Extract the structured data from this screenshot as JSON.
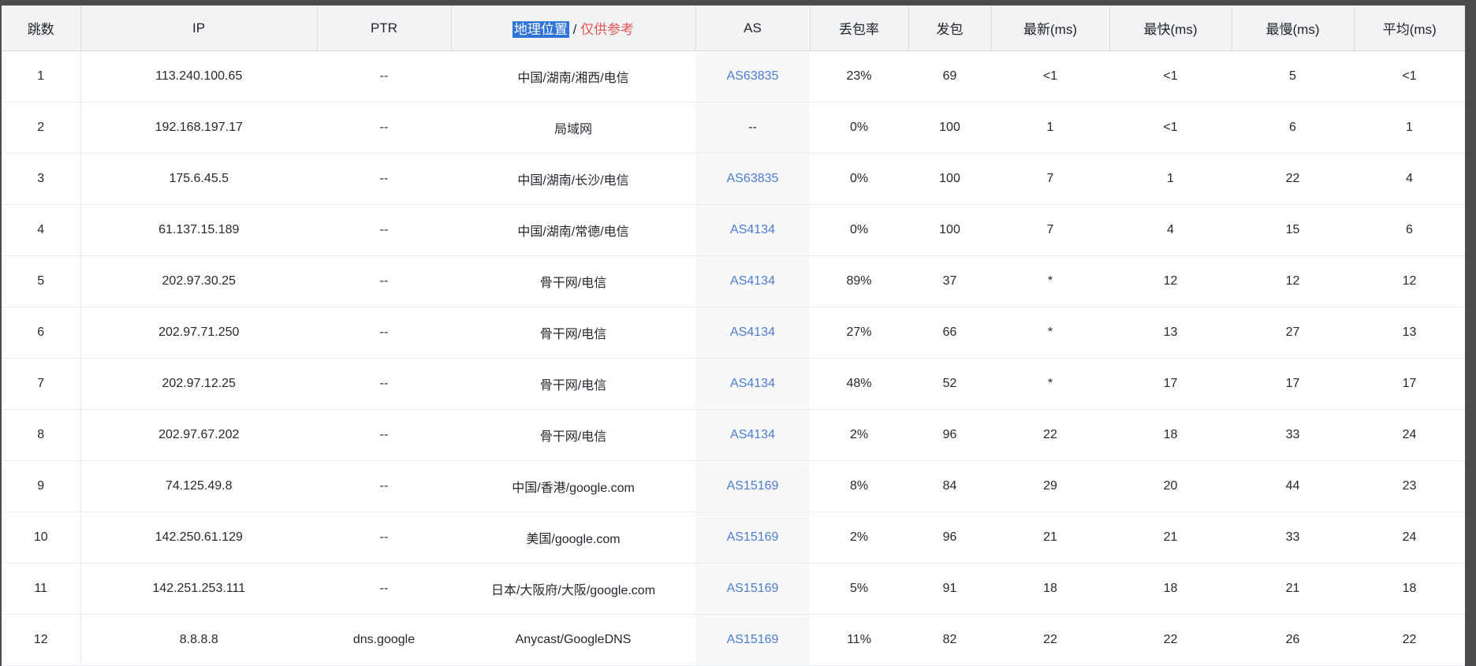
{
  "page": {
    "background_color": "#4c4c4c"
  },
  "table": {
    "header_background": "#f2f3f5",
    "as_link_color": "#4e7bd2",
    "selection_highlight_color": "#2f74d8",
    "note_color": "#e25555",
    "columns": [
      {
        "key": "hop",
        "label": "跳数"
      },
      {
        "key": "ip",
        "label": "IP"
      },
      {
        "key": "ptr",
        "label": "PTR"
      },
      {
        "key": "geo",
        "label": "地理位置",
        "separator": " / ",
        "note": "仅供参考"
      },
      {
        "key": "as",
        "label": "AS"
      },
      {
        "key": "loss",
        "label": "丢包率"
      },
      {
        "key": "sent",
        "label": "发包"
      },
      {
        "key": "latest",
        "label": "最新(ms)"
      },
      {
        "key": "fastest",
        "label": "最快(ms)"
      },
      {
        "key": "slowest",
        "label": "最慢(ms)"
      },
      {
        "key": "average",
        "label": "平均(ms)"
      }
    ],
    "rows": [
      {
        "hop": "1",
        "ip": "113.240.100.65",
        "ptr": "--",
        "geo": "中国/湖南/湘西/电信",
        "as": "AS63835",
        "as_link": true,
        "loss": "23%",
        "sent": "69",
        "latest": "<1",
        "fastest": "<1",
        "slowest": "5",
        "average": "<1"
      },
      {
        "hop": "2",
        "ip": "192.168.197.17",
        "ptr": "--",
        "geo": "局域网",
        "as": "--",
        "as_link": false,
        "loss": "0%",
        "sent": "100",
        "latest": "1",
        "fastest": "<1",
        "slowest": "6",
        "average": "1"
      },
      {
        "hop": "3",
        "ip": "175.6.45.5",
        "ptr": "--",
        "geo": "中国/湖南/长沙/电信",
        "as": "AS63835",
        "as_link": true,
        "loss": "0%",
        "sent": "100",
        "latest": "7",
        "fastest": "1",
        "slowest": "22",
        "average": "4"
      },
      {
        "hop": "4",
        "ip": "61.137.15.189",
        "ptr": "--",
        "geo": "中国/湖南/常德/电信",
        "as": "AS4134",
        "as_link": true,
        "loss": "0%",
        "sent": "100",
        "latest": "7",
        "fastest": "4",
        "slowest": "15",
        "average": "6"
      },
      {
        "hop": "5",
        "ip": "202.97.30.25",
        "ptr": "--",
        "geo": "骨干网/电信",
        "as": "AS4134",
        "as_link": true,
        "loss": "89%",
        "sent": "37",
        "latest": "*",
        "fastest": "12",
        "slowest": "12",
        "average": "12"
      },
      {
        "hop": "6",
        "ip": "202.97.71.250",
        "ptr": "--",
        "geo": "骨干网/电信",
        "as": "AS4134",
        "as_link": true,
        "loss": "27%",
        "sent": "66",
        "latest": "*",
        "fastest": "13",
        "slowest": "27",
        "average": "13"
      },
      {
        "hop": "7",
        "ip": "202.97.12.25",
        "ptr": "--",
        "geo": "骨干网/电信",
        "as": "AS4134",
        "as_link": true,
        "loss": "48%",
        "sent": "52",
        "latest": "*",
        "fastest": "17",
        "slowest": "17",
        "average": "17"
      },
      {
        "hop": "8",
        "ip": "202.97.67.202",
        "ptr": "--",
        "geo": "骨干网/电信",
        "as": "AS4134",
        "as_link": true,
        "loss": "2%",
        "sent": "96",
        "latest": "22",
        "fastest": "18",
        "slowest": "33",
        "average": "24"
      },
      {
        "hop": "9",
        "ip": "74.125.49.8",
        "ptr": "--",
        "geo": "中国/香港/google.com",
        "as": "AS15169",
        "as_link": true,
        "loss": "8%",
        "sent": "84",
        "latest": "29",
        "fastest": "20",
        "slowest": "44",
        "average": "23"
      },
      {
        "hop": "10",
        "ip": "142.250.61.129",
        "ptr": "--",
        "geo": "美国/google.com",
        "as": "AS15169",
        "as_link": true,
        "loss": "2%",
        "sent": "96",
        "latest": "21",
        "fastest": "21",
        "slowest": "33",
        "average": "24"
      },
      {
        "hop": "11",
        "ip": "142.251.253.111",
        "ptr": "--",
        "geo": "日本/大阪府/大阪/google.com",
        "as": "AS15169",
        "as_link": true,
        "loss": "5%",
        "sent": "91",
        "latest": "18",
        "fastest": "18",
        "slowest": "21",
        "average": "18"
      },
      {
        "hop": "12",
        "ip": "8.8.8.8",
        "ptr": "dns.google",
        "geo": "Anycast/GoogleDNS",
        "as": "AS15169",
        "as_link": true,
        "loss": "11%",
        "sent": "82",
        "latest": "22",
        "fastest": "22",
        "slowest": "26",
        "average": "22"
      }
    ]
  }
}
